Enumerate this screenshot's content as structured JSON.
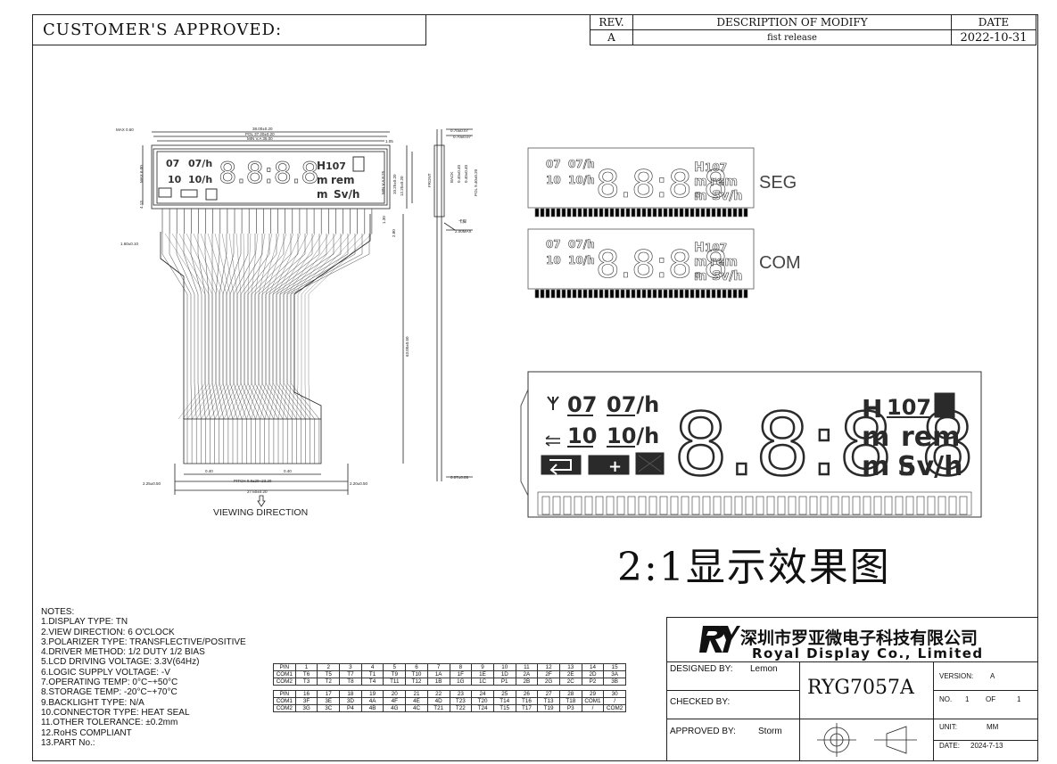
{
  "customer_label": "CUSTOMER'S APPROVED:",
  "revision_table": {
    "headers": [
      "REV.",
      "DESCRIPTION OF MODIFY",
      "DATE"
    ],
    "rows": [
      [
        "A",
        "fist release",
        "2022-10-31"
      ]
    ]
  },
  "lcd_symbols": {
    "row1_left": "07",
    "row1_right": "07/h",
    "row2_left": "10",
    "row2_right": "10/h",
    "digits": "8.8:8.8",
    "h_label": "H",
    "h_value": "107",
    "unit_m": "m",
    "unit_rem": "rem",
    "unit_micro_m": "m",
    "unit_svh": "Sv/h"
  },
  "seg_label": "SEG",
  "com_label": "COM",
  "effect_title": "2:1显示效果图",
  "viewing_direction": "VIEWING DIRECTION",
  "dimensions": {
    "max_left": "MAX 0.60",
    "overall": "38.00±0.20",
    "pol": "POL 37.20±0.20",
    "va": "MIN V.A 36.00",
    "top_right": "1.05",
    "max_h": "MAX 6.00",
    "side_413": "4.13",
    "min_va_825": "MIN V.A 8.25",
    "pol_1025": "10.25±0.20",
    "height_1225": "12.25±0.20",
    "right_130": "1.30",
    "right_280": "2.80",
    "left_160": "1.60±0.10",
    "fpc_len": "63.00±0.50",
    "pad_040a": "0.40",
    "pad_040b": "0.40",
    "left_225": "2.25±0.50",
    "pitch": "PITCH 0.8±29=23.20",
    "right_220": "2.20±0.50",
    "total_2760": "27.60±0.20",
    "front": "FRONT",
    "back": "BACK",
    "side_070": "0.70±0.07",
    "side_070b": "0.70±0.07",
    "side_040": "0.40±0.40",
    "side_940": "POL 9.40±0.20",
    "side_200": "2.00MAX",
    "side_label": "卡脚",
    "side_007": "0.07±0.05",
    "side_040c": "0.40±0.40"
  },
  "notes": [
    "NOTES:",
    "1.DISPLAY TYPE: TN",
    "2.VIEW DIRECTION: 6 O'CLOCK",
    "3.POLARIZER TYPE: TRANSFLECTIVE/POSITIVE",
    "4.DRIVER METHOD: 1/2 DUTY 1/2 BIAS",
    "5.LCD DRIVING VOLTAGE: 3.3V(64Hz)",
    "6.LOGIC SUPPLY VOLTAGE: -V",
    "7.OPERATING TEMP: 0°C~+50°C",
    "8.STORAGE TEMP: -20°C~+70°C",
    "9.BACKLIGHT TYPE: N/A",
    "10.CONNECTOR TYPE: HEAT SEAL",
    "11.OTHER TOLERANCE: ±0.2mm",
    "12.RoHS COMPLIANT",
    "13.PART No.:"
  ],
  "pin_table_1": [
    [
      "PIN",
      "1",
      "2",
      "3",
      "4",
      "5",
      "6",
      "7",
      "8",
      "9",
      "10",
      "11",
      "12",
      "13",
      "14",
      "15"
    ],
    [
      "COM1",
      "T6",
      "T5",
      "T7",
      "T1",
      "T9",
      "T10",
      "1A",
      "1F",
      "1E",
      "1D",
      "2A",
      "2F",
      "2E",
      "2D",
      "3A"
    ],
    [
      "COM2",
      "T3",
      "T2",
      "T8",
      "T4",
      "T11",
      "T12",
      "1B",
      "1G",
      "1C",
      "P1",
      "2B",
      "2G",
      "2C",
      "P2",
      "3B"
    ]
  ],
  "pin_table_2": [
    [
      "PIN",
      "16",
      "17",
      "18",
      "19",
      "20",
      "21",
      "22",
      "23",
      "24",
      "25",
      "26",
      "27",
      "28",
      "29",
      "30"
    ],
    [
      "COM1",
      "3F",
      "3E",
      "3D",
      "4A",
      "4F",
      "4E",
      "4D",
      "T23",
      "T20",
      "T14",
      "T16",
      "T13",
      "T18",
      "COM1",
      "/"
    ],
    [
      "COM2",
      "3G",
      "3C",
      "P4",
      "4B",
      "4G",
      "4C",
      "T21",
      "T22",
      "T24",
      "T15",
      "T17",
      "T19",
      "P3",
      "/",
      "COM2"
    ]
  ],
  "title_block": {
    "company_cn": "深圳市罗亚微电子科技有限公司",
    "company_en": "Royal Display Co., Limited",
    "designed_by_label": "DESIGNED BY:",
    "designed_by": "Lemon",
    "checked_by_label": "CHECKED BY:",
    "approved_by_label": "APPROVED BY:",
    "approved_by": "Storm",
    "part_no": "RYG7057A",
    "version_label": "VERSION:",
    "version": "A",
    "no_label": "NO.",
    "no": "1",
    "of_label": "OF",
    "of": "1",
    "unit_label": "UNIT:",
    "unit": "MM",
    "date_label": "DATE:",
    "date": "2024-7-13"
  },
  "colors": {
    "line": "#222222",
    "lcd_segment": "#2a2a2a"
  }
}
